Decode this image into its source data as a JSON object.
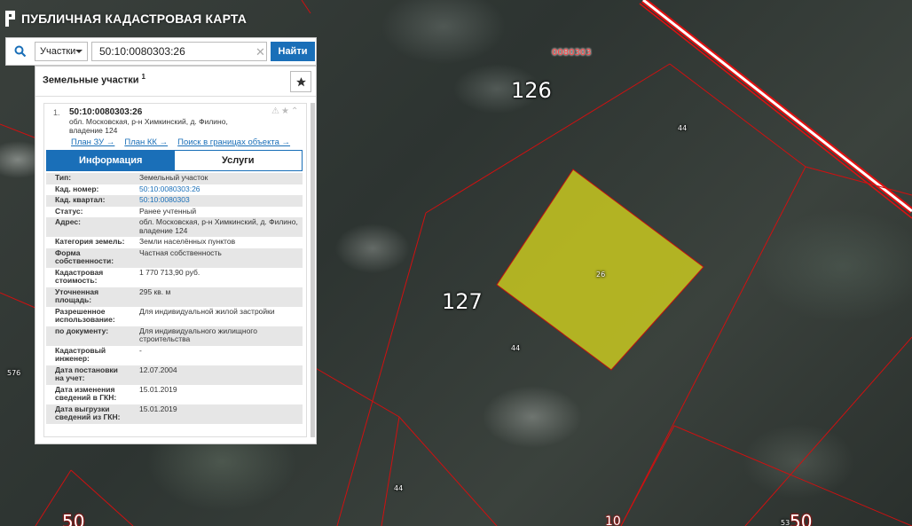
{
  "app": {
    "title": "ПУБЛИЧНАЯ КАДАСТРОВАЯ КАРТА"
  },
  "search": {
    "type_label": "Участки",
    "value": "50:10:0080303:26",
    "button_label": "Найти"
  },
  "panel": {
    "title": "Земельные участки",
    "count": "1",
    "item": {
      "index": "1.",
      "cad_number": "50:10:0080303:26",
      "address": "обл. Московская, р-н Химкинский, д. Филино, владение 124",
      "links": [
        "План ЗУ →",
        "План КК →",
        "Поиск в границах объекта →"
      ],
      "tabs": [
        "Информация",
        "Услуги"
      ],
      "rows": [
        {
          "k": "Тип:",
          "v": "Земельный участок"
        },
        {
          "k": "Кад. номер:",
          "v": "50:10:0080303:26"
        },
        {
          "k": "Кад. квартал:",
          "v": "50:10:0080303"
        },
        {
          "k": "Статус:",
          "v": "Ранее учтенный"
        },
        {
          "k": "Адрес:",
          "v": "обл. Московская, р-н Химкинский, д. Филино, владение 124"
        },
        {
          "k": "Категория земель:",
          "v": "Земли населённых пунктов"
        },
        {
          "k": "Форма собственности:",
          "v": "Частная собственность"
        },
        {
          "k": "Кадастровая стоимость:",
          "v": "1 770 713,90 руб."
        },
        {
          "k": "Уточненная площадь:",
          "v": "295 кв. м"
        },
        {
          "k": "Разрешенное использование:",
          "v": "Для индивидуальной жилой застройки"
        },
        {
          "k": "по документу:",
          "v": "Для индивидуального жилищного строительства"
        },
        {
          "k": "Кадастровый инженер:",
          "v": "-"
        },
        {
          "k": "Дата постановки на учет:",
          "v": "12.07.2004"
        },
        {
          "k": "Дата изменения сведений в ГКН:",
          "v": "15.01.2019"
        },
        {
          "k": "Дата выгрузки сведений из ГКН:",
          "v": "15.01.2019"
        }
      ]
    }
  },
  "map": {
    "quarter_label": "0080303",
    "labels": {
      "l126": "126",
      "l127": "127",
      "l44a": "44",
      "l44b": "44",
      "l44c": "44",
      "l26": "26",
      "l576": "576",
      "l50a": "50",
      "l10": "10",
      "l50b": "50",
      "l53": "53"
    },
    "colors": {
      "border": "#d01010",
      "parcel_fill": "#c8c820",
      "accent": "#1a6fb8"
    }
  }
}
